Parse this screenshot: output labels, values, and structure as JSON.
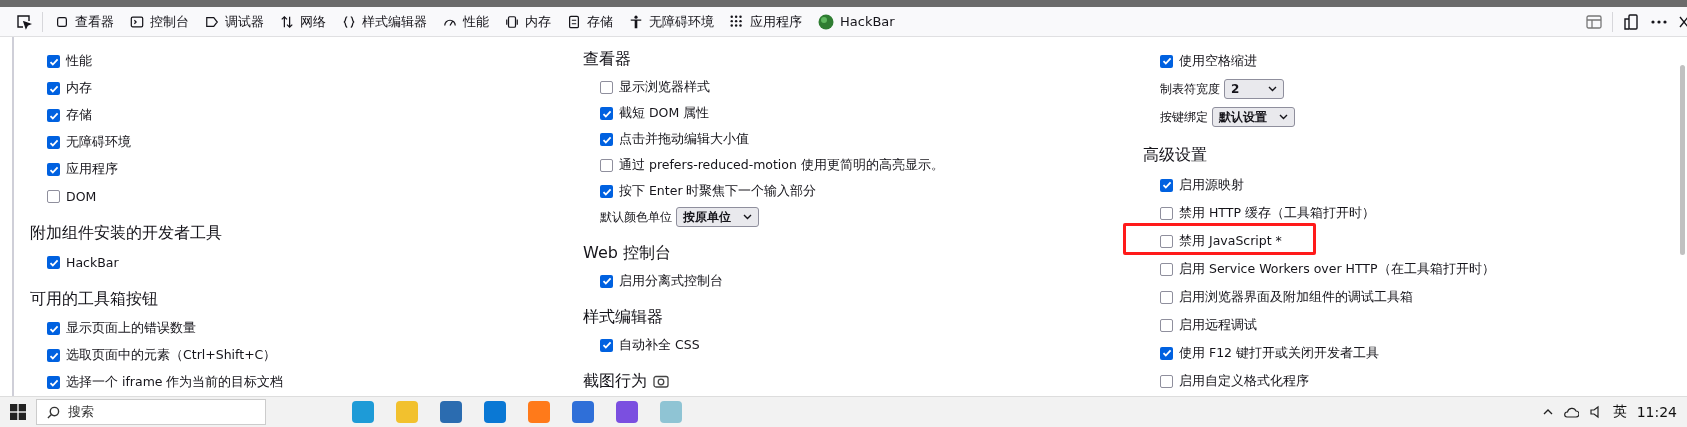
{
  "toolbar": {
    "tabs": [
      {
        "label": "查看器"
      },
      {
        "label": "控制台"
      },
      {
        "label": "调试器"
      },
      {
        "label": "网络"
      },
      {
        "label": "样式编辑器"
      },
      {
        "label": "性能"
      },
      {
        "label": "内存"
      },
      {
        "label": "存储"
      },
      {
        "label": "无障碍环境"
      },
      {
        "label": "应用程序"
      },
      {
        "label": "HackBar"
      }
    ]
  },
  "columns": [
    {
      "items": [
        {
          "kind": "checkbox",
          "label": "性能",
          "checked": true
        },
        {
          "kind": "checkbox",
          "label": "内存",
          "checked": true
        },
        {
          "kind": "checkbox",
          "label": "存储",
          "checked": true
        },
        {
          "kind": "checkbox",
          "label": "无障碍环境",
          "checked": true
        },
        {
          "kind": "checkbox",
          "label": "应用程序",
          "checked": true
        },
        {
          "kind": "checkbox",
          "label": "DOM",
          "checked": false
        },
        {
          "kind": "heading",
          "label": "附加组件安装的开发者工具"
        },
        {
          "kind": "checkbox",
          "label": "HackBar",
          "checked": true
        },
        {
          "kind": "heading",
          "label": "可用的工具箱按钮"
        },
        {
          "kind": "checkbox",
          "label": "显示页面上的错误数量",
          "checked": true
        },
        {
          "kind": "checkbox",
          "label": "选取页面中的元素（Ctrl+Shift+C）",
          "checked": true
        },
        {
          "kind": "checkbox",
          "label": "选择一个 iframe 作为当前的目标文档",
          "checked": true
        }
      ]
    },
    {
      "items": [
        {
          "kind": "heading",
          "label": "查看器"
        },
        {
          "kind": "checkbox",
          "label": "显示浏览器样式",
          "checked": false
        },
        {
          "kind": "checkbox",
          "label": "截短 DOM 属性",
          "checked": true
        },
        {
          "kind": "checkbox",
          "label": "点击并拖动编辑大小值",
          "checked": true
        },
        {
          "kind": "checkbox",
          "label": "通过 prefers-reduced-motion 使用更简明的高亮显示。",
          "checked": false
        },
        {
          "kind": "checkbox",
          "label": "按下 Enter 时聚焦下一个输入部分",
          "checked": true
        },
        {
          "kind": "select",
          "label": "默认颜色单位",
          "value": "按原单位"
        },
        {
          "kind": "heading",
          "label": "Web 控制台"
        },
        {
          "kind": "checkbox",
          "label": "启用分离式控制台",
          "checked": true
        },
        {
          "kind": "heading",
          "label": "样式编辑器"
        },
        {
          "kind": "checkbox",
          "label": "自动补全 CSS",
          "checked": true
        },
        {
          "kind": "cameraheading",
          "label": "截图行为"
        }
      ]
    },
    {
      "items": [
        {
          "kind": "checkbox",
          "label": "使用空格缩进",
          "checked": true
        },
        {
          "kind": "select",
          "label": "制表符宽度",
          "value": "2"
        },
        {
          "kind": "select",
          "label": "按键绑定",
          "value": "默认设置"
        },
        {
          "kind": "heading",
          "label": "高级设置"
        },
        {
          "kind": "checkbox",
          "label": "启用源映射",
          "checked": true
        },
        {
          "kind": "checkbox",
          "label": "禁用 HTTP 缓存（工具箱打开时）",
          "checked": false
        },
        {
          "kind": "checkbox",
          "label": "禁用 JavaScript *",
          "checked": false,
          "highlighted": true
        },
        {
          "kind": "checkbox",
          "label": "启用 Service Workers over HTTP（在工具箱打开时）",
          "checked": false
        },
        {
          "kind": "checkbox",
          "label": "启用浏览器界面及附加组件的调试工具箱",
          "checked": false
        },
        {
          "kind": "checkbox",
          "label": "启用远程调试",
          "checked": false
        },
        {
          "kind": "checkbox",
          "label": "使用 F12 键打开或关闭开发者工具",
          "checked": true
        },
        {
          "kind": "checkbox",
          "label": "启用自定义格式化程序",
          "checked": false
        }
      ]
    }
  ],
  "taskbar": {
    "search": {
      "placeholder": "搜索"
    },
    "language": "英",
    "time": "11:24"
  }
}
